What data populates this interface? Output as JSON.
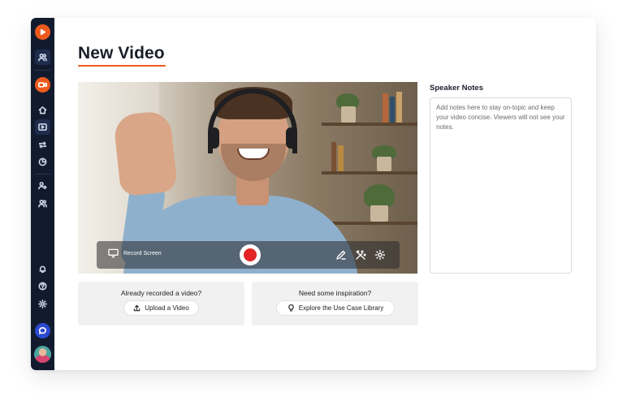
{
  "page": {
    "title": "New Video"
  },
  "sidebar": {
    "items": [
      {
        "name": "logo-play",
        "icon": "play-icon"
      },
      {
        "name": "team",
        "icon": "users-icon"
      },
      {
        "name": "record",
        "icon": "video-camera-icon"
      },
      {
        "name": "home",
        "icon": "home-icon"
      },
      {
        "name": "videos",
        "icon": "play-square-icon"
      },
      {
        "name": "share",
        "icon": "repeat-icon"
      },
      {
        "name": "analytics",
        "icon": "pie-chart-icon"
      },
      {
        "name": "user-settings",
        "icon": "user-cog-icon"
      },
      {
        "name": "people",
        "icon": "users-icon"
      },
      {
        "name": "notifications",
        "icon": "bell-icon"
      },
      {
        "name": "help",
        "icon": "help-circle-icon"
      },
      {
        "name": "settings",
        "icon": "gear-icon"
      },
      {
        "name": "chat",
        "icon": "chat-icon"
      }
    ]
  },
  "recorder": {
    "record_screen_label": "Record Screen"
  },
  "cards": {
    "upload": {
      "title": "Already recorded a video?",
      "button": "Upload a Video"
    },
    "inspiration": {
      "title": "Need some inspiration?",
      "button": "Explore the Use Case Library"
    }
  },
  "notes": {
    "title": "Speaker Notes",
    "placeholder": "Add notes here to stay on-topic and keep your video concise. Viewers will not see your notes.",
    "value": ""
  },
  "colors": {
    "accent": "#ee5a1c",
    "sidebar_bg": "#121b2e",
    "record_red": "#e32424",
    "chat_blue": "#2c4ad1"
  }
}
